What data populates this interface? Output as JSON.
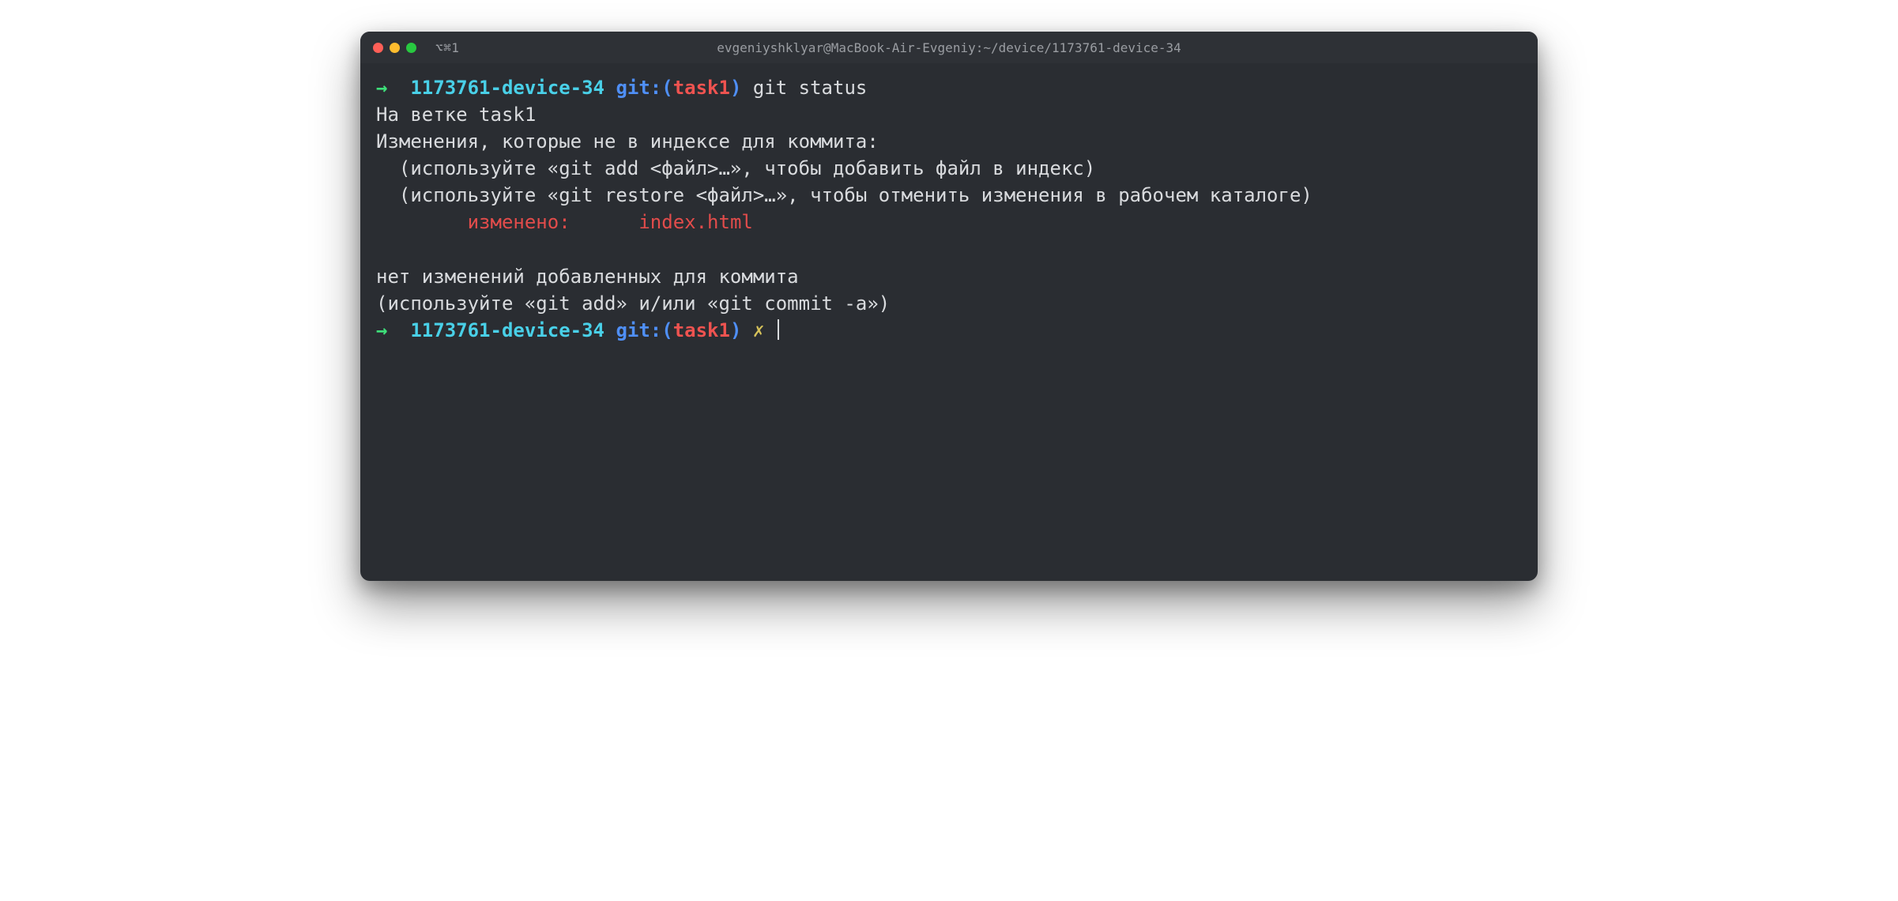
{
  "titlebar": {
    "tab_label": "⌥⌘1",
    "window_title": "evgeniyshklyar@MacBook-Air-Evgeniy:~/device/1173761-device-34"
  },
  "prompt1": {
    "arrow": "→",
    "cwd": "1173761-device-34",
    "git_prefix": "git:(",
    "branch": "task1",
    "git_suffix": ")",
    "command": "git status"
  },
  "output": {
    "line1": "На ветке task1",
    "line2": "Изменения, которые не в индексе для коммита:",
    "line3": "  (используйте «git add <файл>…», чтобы добавить файл в индекс)",
    "line4": "  (используйте «git restore <файл>…», чтобы отменить изменения в рабочем каталоге)",
    "line5_label": "        изменено:      ",
    "line5_file": "index.html",
    "line6": "",
    "line7": "нет изменений добавленных для коммита",
    "line8": "(используйте «git add» и/или «git commit -a»)"
  },
  "prompt2": {
    "arrow": "→",
    "cwd": "1173761-device-34",
    "git_prefix": "git:(",
    "branch": "task1",
    "git_suffix": ")",
    "dirty_marker": "✗"
  }
}
